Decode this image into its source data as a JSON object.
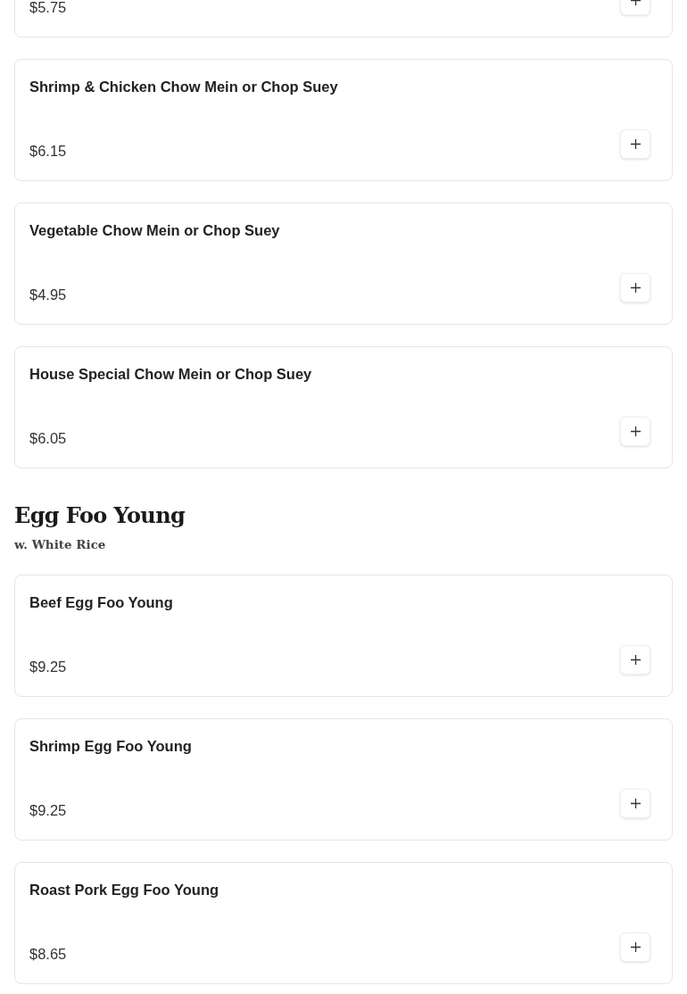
{
  "sections": [
    {
      "items": [
        {
          "price": "$5.75"
        },
        {
          "name": "Shrimp & Chicken Chow Mein or Chop Suey",
          "price": "$6.15"
        },
        {
          "name": "Vegetable Chow Mein or Chop Suey",
          "price": "$4.95"
        },
        {
          "name": "House Special Chow Mein or Chop Suey",
          "price": "$6.05"
        }
      ]
    },
    {
      "title": "Egg Foo Young",
      "subtitle": "w. White Rice",
      "items": [
        {
          "name": "Beef Egg Foo Young",
          "price": "$9.25"
        },
        {
          "name": "Shrimp Egg Foo Young",
          "price": "$9.25"
        },
        {
          "name": "Roast Pork Egg Foo Young",
          "price": "$8.65"
        }
      ]
    }
  ]
}
